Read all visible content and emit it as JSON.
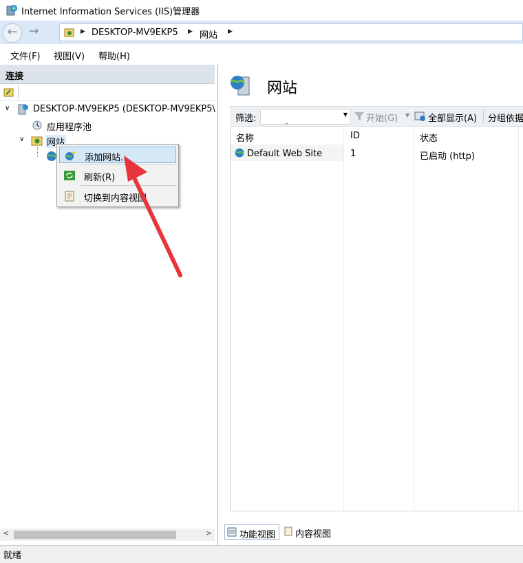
{
  "window": {
    "title": "Internet Information Services (IIS)管理器"
  },
  "address": {
    "crumbs": [
      "DESKTOP-MV9EKP5",
      "网站"
    ]
  },
  "menu": {
    "items": [
      "文件(F)",
      "视图(V)",
      "帮助(H)"
    ]
  },
  "connections": {
    "header": "连接",
    "tree": {
      "server": "DESKTOP-MV9EKP5 (DESKTOP-MV9EKP5\\",
      "app_pools": "应用程序池",
      "sites": "网站"
    }
  },
  "context_menu": {
    "items": [
      {
        "label": "添加网站...",
        "icon": "add-site-icon"
      },
      {
        "label": "刷新(R)",
        "icon": "refresh-icon"
      },
      {
        "label": "切换到内容视图",
        "icon": "content-view-icon"
      }
    ]
  },
  "main": {
    "heading": "网站",
    "filter": {
      "label": "筛选:",
      "start": "开始(G)",
      "show_all": "全部显示(A)",
      "group_by": "分组依据"
    },
    "columns": [
      "名称",
      "ID",
      "状态"
    ],
    "rows": [
      {
        "name": "Default Web Site",
        "id": "1",
        "status": "已启动 (http)"
      }
    ],
    "view_tabs": [
      "功能视图",
      "内容视图"
    ]
  },
  "status": {
    "text": "就绪"
  },
  "colors": {
    "accent": "#dae8f7",
    "arrow": "#e8343a",
    "selection": "#d5e8f7"
  }
}
